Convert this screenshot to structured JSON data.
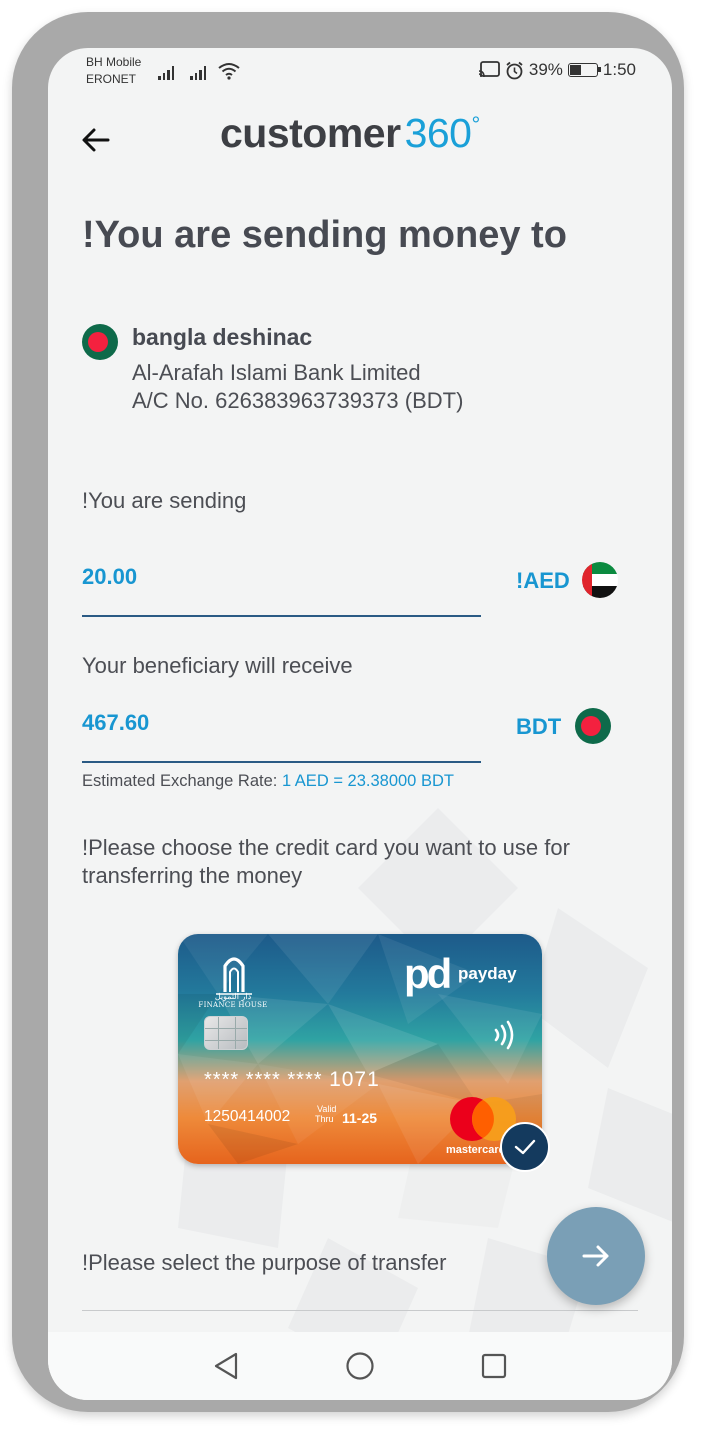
{
  "status_bar": {
    "carrier_line1": "BH Mobile",
    "carrier_line2": "ERONET",
    "battery": "39%",
    "time": "1:50"
  },
  "header": {
    "logo_word": "customer",
    "logo_number": "360",
    "logo_degree": "°"
  },
  "page_title": "!You are sending money to",
  "beneficiary": {
    "name": "bangla deshinac",
    "bank": "Al-Arafah Islami Bank Limited",
    "account": "A/C No. 626383963739373 (BDT)"
  },
  "send": {
    "label": "!You are sending",
    "amount": "20.00",
    "currency": "!AED"
  },
  "receive": {
    "label": "Your beneficiary will receive",
    "amount": "467.60",
    "currency": "BDT"
  },
  "exchange_rate": {
    "label": "Estimated Exchange Rate:",
    "value": "1 AED = 23.38000 BDT"
  },
  "card_prompt": "!Please choose the credit card you want to use for transferring the money",
  "card": {
    "issuer_text": "FINANCE HOUSE",
    "issuer_arabic": "دار التمويل",
    "brand_mark": "pd",
    "brand_name": "payday",
    "masked_number": "**** **** ****",
    "last_digits": "1071",
    "account_number": "1250414002",
    "valid_label_1": "Valid",
    "valid_label_2": "Thru",
    "expiry": "11-25",
    "network": "mastercard"
  },
  "purpose_label": "!Please select the purpose of transfer",
  "colors": {
    "accent": "#1896d1",
    "title": "#474a52",
    "fab": "#7a9fb6",
    "check_badge": "#143a5e"
  }
}
